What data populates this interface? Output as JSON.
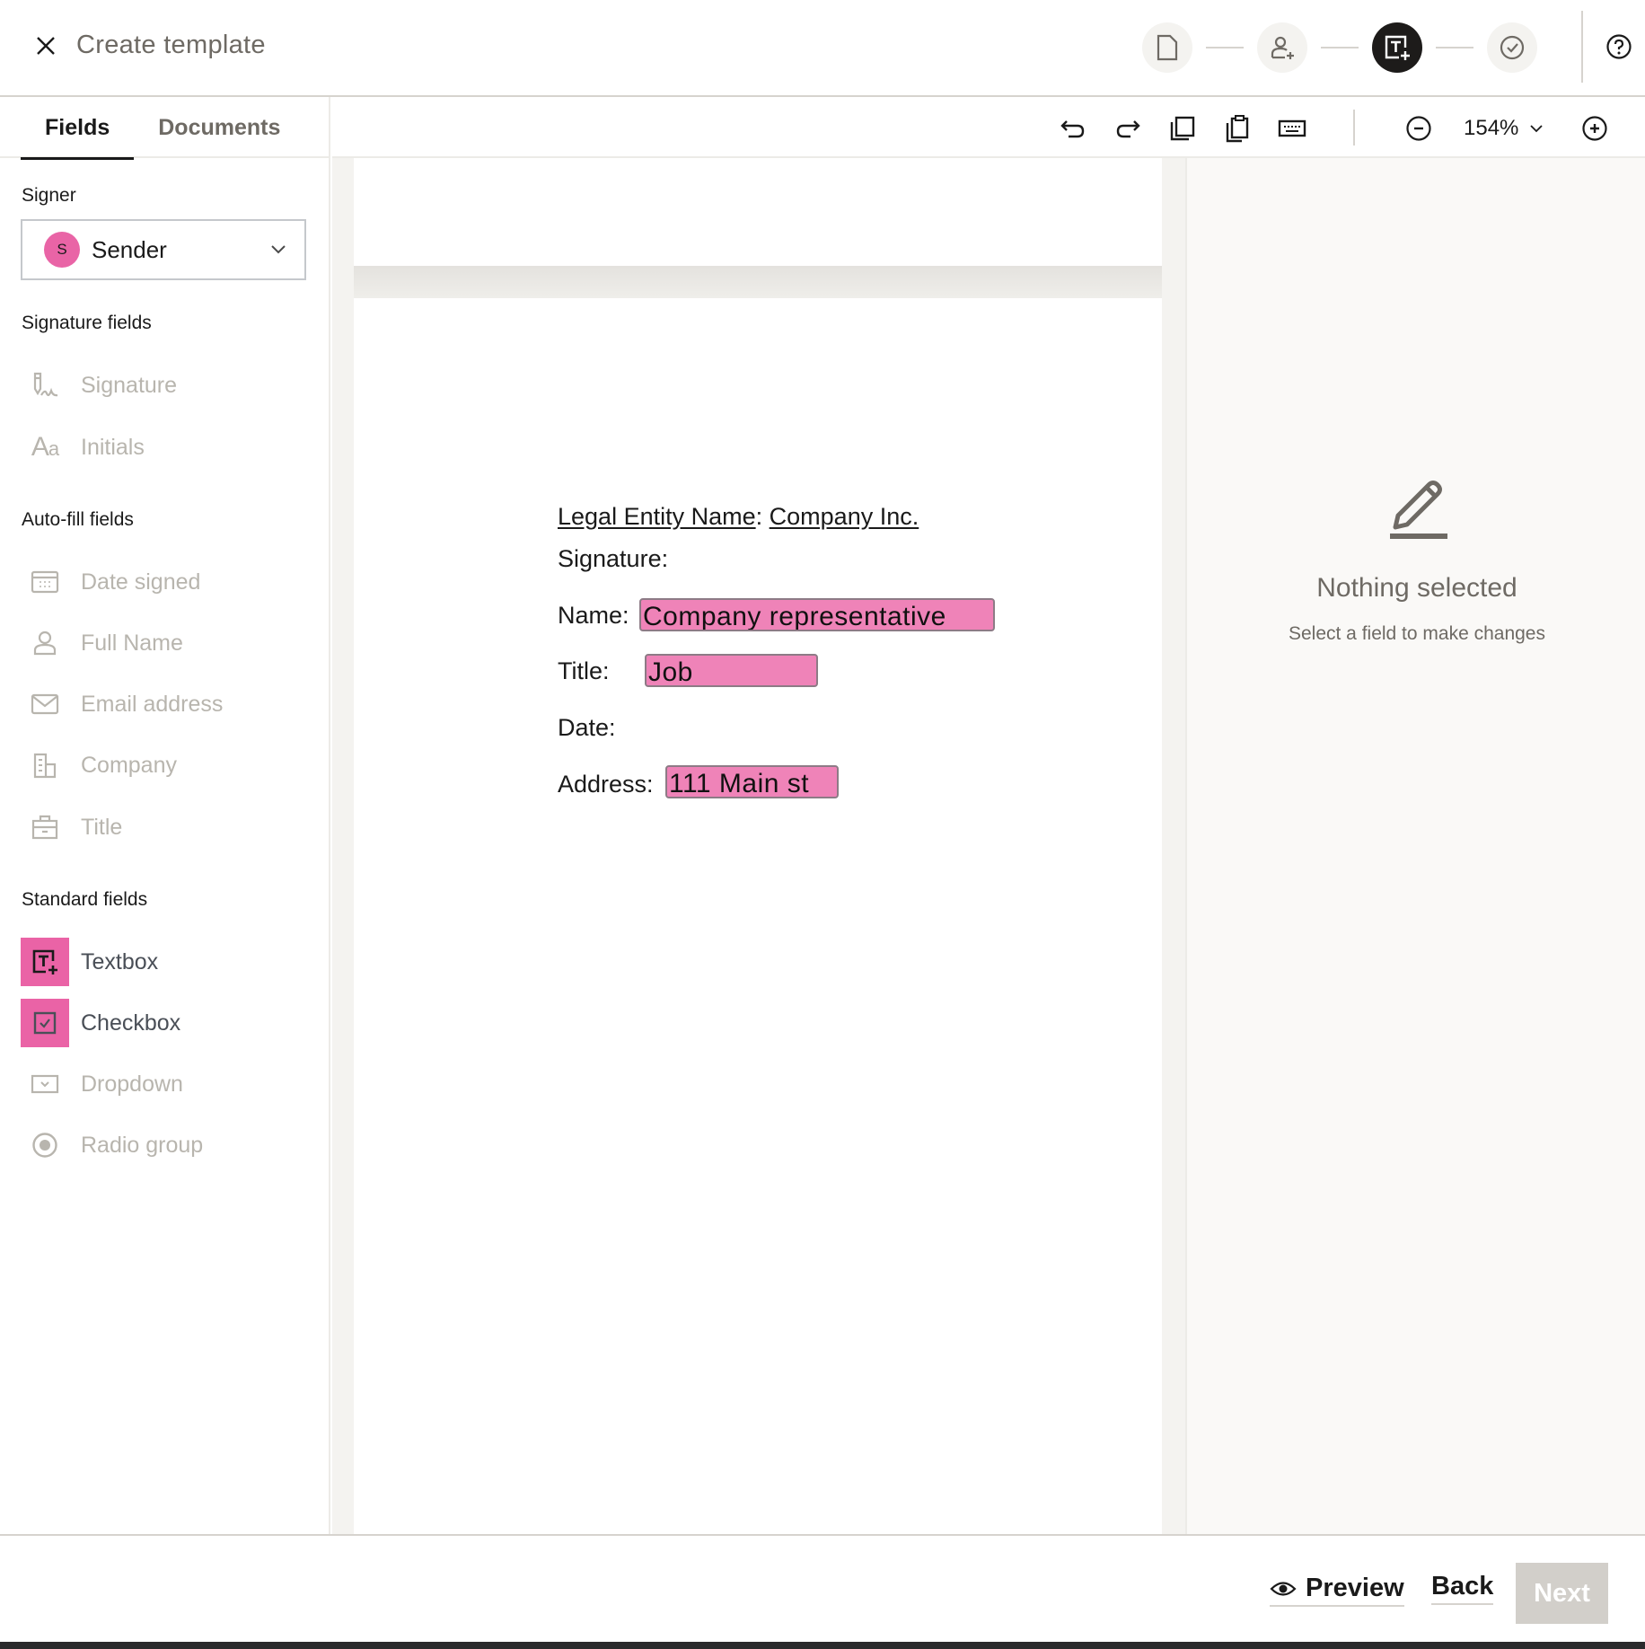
{
  "header": {
    "title": "Create template",
    "steps": [
      {
        "name": "document",
        "active": false
      },
      {
        "name": "add-signer",
        "active": false
      },
      {
        "name": "add-fields",
        "active": true
      },
      {
        "name": "review",
        "active": false
      }
    ]
  },
  "sidebar": {
    "tabs": [
      {
        "label": "Fields",
        "active": true
      },
      {
        "label": "Documents",
        "active": false
      }
    ],
    "signer_label": "Signer",
    "signer": {
      "initial": "S",
      "name": "Sender",
      "color": "#e964a6"
    },
    "signature_section": "Signature fields",
    "signature_fields": [
      {
        "label": "Signature",
        "icon": "signature-icon",
        "enabled": false
      },
      {
        "label": "Initials",
        "icon": "initials-icon",
        "enabled": false
      }
    ],
    "autofill_section": "Auto-fill fields",
    "autofill_fields": [
      {
        "label": "Date signed",
        "icon": "calendar-icon",
        "enabled": false
      },
      {
        "label": "Full Name",
        "icon": "person-icon",
        "enabled": false
      },
      {
        "label": "Email address",
        "icon": "envelope-icon",
        "enabled": false
      },
      {
        "label": "Company",
        "icon": "building-icon",
        "enabled": false
      },
      {
        "label": "Title",
        "icon": "briefcase-icon",
        "enabled": false
      }
    ],
    "standard_section": "Standard fields",
    "standard_fields": [
      {
        "label": "Textbox",
        "icon": "textbox-icon",
        "enabled": true
      },
      {
        "label": "Checkbox",
        "icon": "checkbox-icon",
        "enabled": true
      },
      {
        "label": "Dropdown",
        "icon": "dropdown-icon",
        "enabled": false
      },
      {
        "label": "Radio group",
        "icon": "radio-icon",
        "enabled": false
      }
    ]
  },
  "toolbar": {
    "zoom": "154%"
  },
  "document": {
    "legal_entity_label": "Legal Entity Name",
    "legal_entity_colon": ":",
    "legal_entity_value": " Company Inc.",
    "signature_label": "Signature:",
    "name_label": "Name:",
    "name_value": "Company representative",
    "title_label": "Title:",
    "title_value": "Job",
    "date_label": "Date:",
    "address_label": "Address:",
    "address_value": "111 Main st",
    "field_color": "#ef83b8"
  },
  "right_panel": {
    "title": "Nothing selected",
    "subtitle": "Select a field to make changes"
  },
  "footer": {
    "preview_label": "Preview",
    "back_label": "Back",
    "next_label": "Next"
  }
}
